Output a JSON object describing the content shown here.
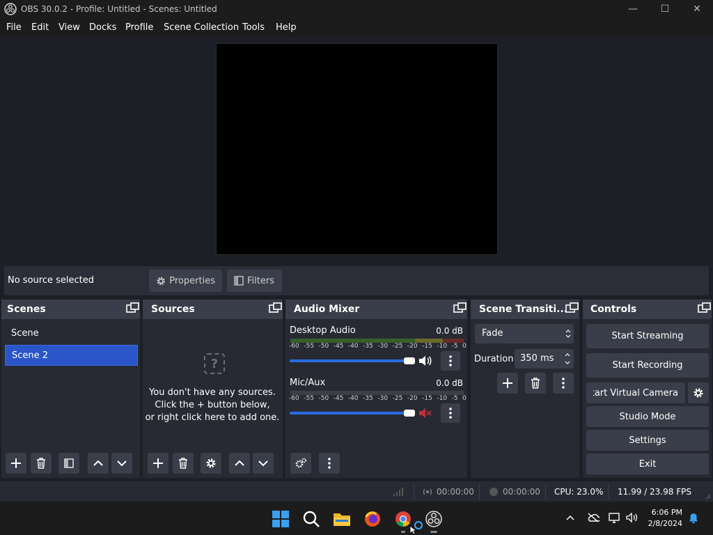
{
  "window": {
    "title": "OBS 30.0.2 - Profile: Untitled - Scenes: Untitled",
    "minimize_glyph": "—",
    "maximize_glyph": "☐",
    "close_glyph": "✕"
  },
  "menu": {
    "items": [
      "File",
      "Edit",
      "View",
      "Docks",
      "Profile",
      "Scene Collection",
      "Tools",
      "Help"
    ]
  },
  "source_toolbar": {
    "status": "No source selected",
    "properties_label": "Properties",
    "filters_label": "Filters"
  },
  "scenes": {
    "title": "Scenes",
    "items": [
      "Scene",
      "Scene 2"
    ],
    "selected_index": 1
  },
  "sources": {
    "title": "Sources",
    "empty_lines": [
      "You don't have any sources.",
      "Click the + button below,",
      "or right click here to add one."
    ]
  },
  "audio_mixer": {
    "title": "Audio Mixer",
    "channels": [
      {
        "name": "Desktop Audio",
        "db": "0.0 dB",
        "muted": false
      },
      {
        "name": "Mic/Aux",
        "db": "0.0 dB",
        "muted": true
      }
    ],
    "ticks": [
      "-60",
      "-55",
      "-50",
      "-45",
      "-40",
      "-35",
      "-30",
      "-25",
      "-20",
      "-15",
      "-10",
      "-5",
      "0"
    ]
  },
  "transitions": {
    "title": "Scene Transiti...",
    "selected": "Fade",
    "duration_label": "Duration",
    "duration_value": "350 ms"
  },
  "controls": {
    "title": "Controls",
    "start_streaming": "Start Streaming",
    "start_recording": "Start Recording",
    "start_virtual_camera": "Start Virtual Camera",
    "studio_mode": "Studio Mode",
    "settings": "Settings",
    "exit": "Exit"
  },
  "status_bar": {
    "stream_time": "00:00:00",
    "record_time": "00:00:00",
    "cpu": "CPU: 23.0%",
    "fps": "11.99 / 23.98 FPS"
  },
  "taskbar": {
    "time": "6:06 PM",
    "date": "2/8/2024"
  },
  "colors": {
    "accent": "#2a56c9",
    "slider": "#2a6be0",
    "muted_icon": "#c0303a"
  }
}
